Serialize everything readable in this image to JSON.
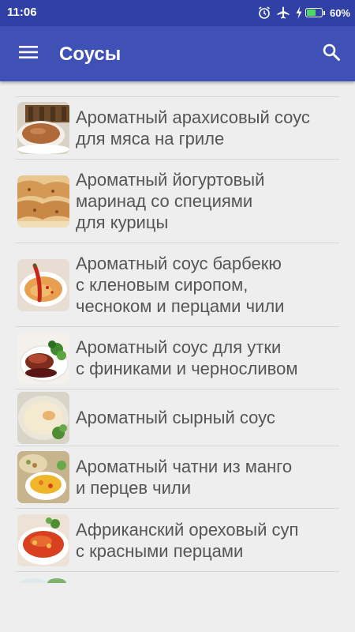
{
  "status_bar": {
    "time": "11:06",
    "battery_percent": "60%",
    "battery_level": 0.6,
    "icons": [
      "alarm-icon",
      "airplane-mode-icon",
      "charging-icon",
      "battery-icon"
    ]
  },
  "app_bar": {
    "title": "Соусы",
    "menu_icon": "hamburger-menu-icon",
    "search_icon": "search-icon",
    "background": "#3f51b5",
    "status_background": "#3041a6"
  },
  "recipes": [
    {
      "title": "Ароматный арахисовый соус\nдля мяса на гриле"
    },
    {
      "title": "Ароматный йогуртовый\nмаринад со специями\nдля курицы"
    },
    {
      "title": "Ароматный соус барбекю\nс кленовым сиропом,\nчесноком и перцами чили"
    },
    {
      "title": "Ароматный соус для утки\nс финиками и черносливом"
    },
    {
      "title": "Ароматный сырный соус"
    },
    {
      "title": "Ароматный чатни из манго\nи перцев чили"
    },
    {
      "title": "Африканский ореховый суп\nс красными перцами"
    },
    {
      "title": ""
    }
  ]
}
